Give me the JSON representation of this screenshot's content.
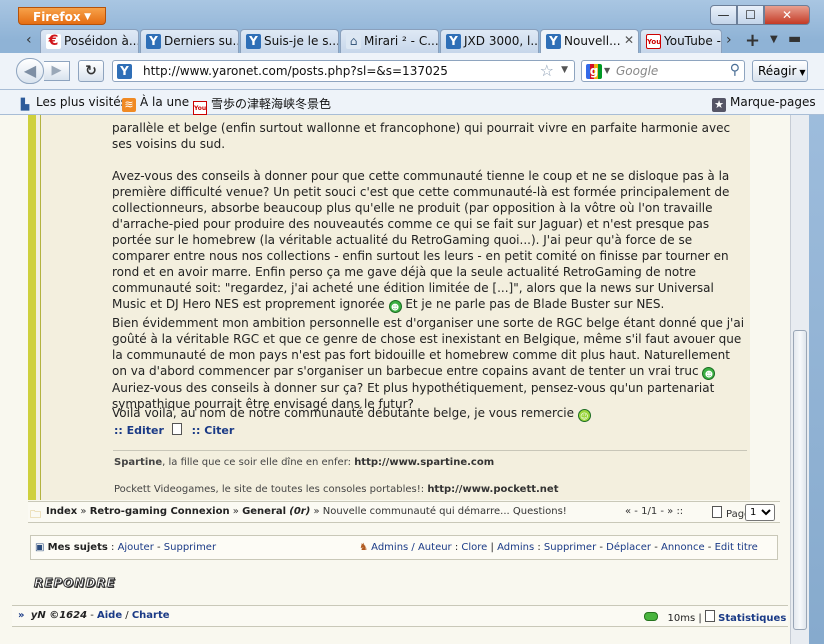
{
  "browser": {
    "app_button": "Firefox",
    "window_controls": {
      "minimize": "—",
      "maximize": "☐",
      "close": "✕"
    },
    "tabs": [
      {
        "label": "Poséidon à...",
        "icon": "ep"
      },
      {
        "label": "Derniers su...",
        "icon": "ya"
      },
      {
        "label": "Suis-je le s...",
        "icon": "ya"
      },
      {
        "label": "Mirari ² - C...",
        "icon": "house"
      },
      {
        "label": "JXD 3000, l...",
        "icon": "ya"
      },
      {
        "label": "Nouvell...",
        "icon": "ya",
        "active": true
      },
      {
        "label": "YouTube -",
        "icon": "yt"
      }
    ],
    "url": "http://www.yaronet.com/posts.php?sl=&s=137025",
    "search_placeholder": "Google",
    "reagir_label": "Réagir",
    "bookmarks": [
      {
        "label": "Les plus visités"
      },
      {
        "label": "À la une"
      },
      {
        "label": "雪歩の津軽海峡冬景色"
      }
    ],
    "bookmarks_menu": "Marque-pages"
  },
  "post": {
    "p1": "parallèle et belge (enfin surtout wallonne et francophone) qui pourrait vivre en parfaite harmonie avec ses voisins du sud.",
    "p2": "Avez-vous des conseils à donner pour que cette communauté tienne le coup et ne se disloque pas à la première difficulté venue? Un petit souci c'est que cette communauté-là est formée principalement de collectionneurs, absorbe beaucoup plus qu'elle ne produit (par opposition à la vôtre où l'on travaille d'arrache-pied pour produire des nouveautés comme ce qui se fait sur Jaguar) et n'est presque pas portée sur le homebrew (la véritable actualité du RetroGaming quoi...). J'ai peur qu'à force de se comparer entre nous nos collections - enfin surtout les leurs - en petit comité on finisse par tourner en rond et en avoir marre. Enfin perso ça me gave déjà que la seule actualité RetroGaming de notre communauté soit: \"regardez, j'ai acheté une édition limitée de [...]\", alors que la news sur Universal Music et DJ Hero NES est proprement ignorée",
    "p2_tail": "Et je ne parle pas de Blade Buster sur NES.",
    "p3": "Bien évidemment mon ambition personnelle est d'organiser une sorte de RGC belge étant donné que j'ai goûté à la véritable RGC et que ce genre de chose est inexistant en Belgique, même s'il faut avouer que la communauté de mon pays n'est pas fort bidouille et homebrew comme dit plus haut. Naturellement on va d'abord commencer par s'organiser un barbecue entre copains avant de tenter un vrai truc",
    "p3_tail": "Auriez-vous des conseils à donner sur ça? Et plus hypothétiquement, pensez-vous qu'un partenariat sympathique pourrait être envisagé dans le futur?",
    "p4": "Voilà voilà, au nom de notre communauté débutante belge, je vous remercie",
    "edit_label": ":: Editer",
    "quote_label": ":: Citer",
    "sig1_name": "Spartine",
    "sig1_text": ", la fille que ce soir elle dîne en enfer: ",
    "sig1_url": "http://www.spartine.com",
    "sig2_text": "Pockett Videogames, le site de toutes les consoles portables!: ",
    "sig2_url": "http://www.pockett.net"
  },
  "breadcrumb": {
    "index": "Index",
    "cat": "Retro-gaming Connexion",
    "forum": "General",
    "forum_tag": "(0r)",
    "topic": "Nouvelle communauté qui démarre... Questions!",
    "sep": "»",
    "pager": "« - 1/1 - » ::",
    "pages_label": "Pages",
    "page_value": "1"
  },
  "mysubjects": {
    "label": "Mes sujets",
    "add": "Ajouter",
    "remove": "Supprimer",
    "admins_label": "Admins / Auteur",
    "clore": "Clore",
    "admins": "Admins",
    "a_supprimer": "Supprimer",
    "deplacer": "Déplacer",
    "annonce": "Annonce",
    "edit_title": "Edit titre"
  },
  "reply_label": "REPONDRE",
  "footer": {
    "brand": "yN ©1624",
    "help": "Aide",
    "charter": "Charte",
    "time": "10ms",
    "stats": "Statistiques"
  }
}
